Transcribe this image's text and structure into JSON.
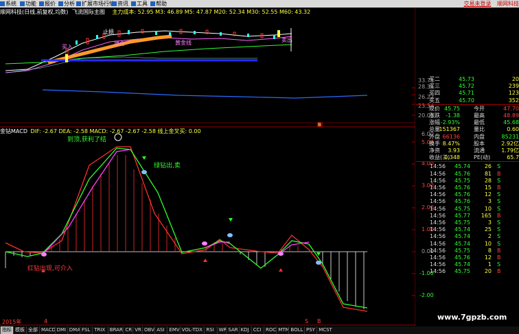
{
  "menu": {
    "items": [
      "系统",
      "功能",
      "报价",
      "分析",
      "扩展市场行情",
      "资讯",
      "工具",
      "帮助"
    ],
    "right_links": [
      "交易未登录",
      "顺网科技"
    ]
  },
  "top_panel": {
    "title": "顺网科技(日线,前复权,均数)",
    "indicator_name": "飞流国际主图",
    "indicators_text": "主力成本: 52.95  M3: 46.89  M5: 47.87  M20: 52.34  M30: 52.55  M60: 43.32",
    "annotations": [
      "止损",
      "建仓",
      "黄金线",
      "买入",
      "卖出"
    ],
    "y_ticks": [
      "33.71",
      "28.31",
      "26.22",
      "23.34",
      "20.05"
    ],
    "marker": "B"
  },
  "macd_panel": {
    "header_name": "金钻MACD",
    "header_values": "DIF: -2.67  DEA: -2.58  MACD: -2.67  -2.67  -2.58  线上金叉买: 0.00",
    "notes": {
      "top": "到顶,获利了结",
      "green_sell": "绿钻出,卖",
      "red_buy": "红钻出现,可介入"
    },
    "y_ticks": [
      "6.00",
      "5.00",
      "4.00",
      "3.00",
      "2.00",
      "1.00",
      "0.00",
      "-1.00",
      "-2.00"
    ],
    "bottom_labels": {
      "year": "2015年",
      "month": "4",
      "s_mark": "S",
      "b_mark": "B"
    }
  },
  "quote": {
    "bid_rows": [
      {
        "label": "买二",
        "price": "45.73",
        "vol": "20"
      },
      {
        "label": "买三",
        "price": "45.72",
        "vol": "239"
      },
      {
        "label": "买四",
        "price": "45.71",
        "vol": "123"
      },
      {
        "label": "买五",
        "price": "45.70",
        "vol": "352"
      }
    ],
    "stats": [
      {
        "l1": "现价",
        "v1": "45.75",
        "l2": "今开",
        "v2": "47.70"
      },
      {
        "l1": "涨跌",
        "v1": "-1.38",
        "l2": "最高",
        "v2": "48.89"
      },
      {
        "l1": "涨幅",
        "v1": "-2.93%",
        "l2": "最低",
        "v2": "45.68"
      },
      {
        "l1": "总量",
        "v1": "151367",
        "l2": "量比",
        "v2": "0.60"
      },
      {
        "l1": "外盘",
        "v1": "66136",
        "l2": "内盘",
        "v2": "85231"
      },
      {
        "l1": "换手",
        "v1": "8.47%",
        "l2": "股本",
        "v2": "2.92亿"
      },
      {
        "l1": "净资",
        "v1": "3.93",
        "l2": "流通",
        "v2": "1.79亿"
      },
      {
        "l1": "收益(三)",
        "v1": "0.348",
        "l2": "PE(动)",
        "v2": "65.7"
      }
    ],
    "ticks": [
      {
        "t": "14:56",
        "p": "45.74",
        "v": "26",
        "d": "S"
      },
      {
        "t": "14:56",
        "p": "45.76",
        "v": "81",
        "d": "B"
      },
      {
        "t": "14:56",
        "p": "45.75",
        "v": "28",
        "d": "S"
      },
      {
        "t": "14:56",
        "p": "45.76",
        "v": "15",
        "d": "B"
      },
      {
        "t": "14:56",
        "p": "45.76",
        "v": "12",
        "d": "S"
      },
      {
        "t": "14:56",
        "p": "45.76",
        "v": "3",
        "d": "S"
      },
      {
        "t": "14:56",
        "p": "45.75",
        "v": "10",
        "d": "S"
      },
      {
        "t": "14:56",
        "p": "45.77",
        "v": "165",
        "d": "B"
      },
      {
        "t": "14:56",
        "p": "45.75",
        "v": "3",
        "d": "S"
      },
      {
        "t": "14:56",
        "p": "45.74",
        "v": "25",
        "d": "S"
      },
      {
        "t": "14:56",
        "p": "45.74",
        "v": "2",
        "d": "S"
      },
      {
        "t": "14:56",
        "p": "45.74",
        "v": "10",
        "d": "S"
      },
      {
        "t": "14:56",
        "p": "45.75",
        "v": "8",
        "d": "B"
      },
      {
        "t": "14:56",
        "p": "45.76",
        "v": "12",
        "d": "B"
      },
      {
        "t": "14:56",
        "p": "45.74",
        "v": "1",
        "d": "S"
      },
      {
        "t": "14:56",
        "p": "45.75",
        "v": "20",
        "d": "B"
      }
    ]
  },
  "tabs": [
    "指标",
    "模板",
    "全部",
    "MACD",
    "DMI",
    "DMA",
    "FSL",
    "TRIX",
    "BRAR",
    "CR",
    "VR",
    "OBV",
    "ASI",
    "EMV",
    "VOL-TDX",
    "RSI",
    "WR",
    "SAR",
    "KDJ",
    "CCI",
    "ROC",
    "MTM",
    "BOLL",
    "PSY",
    "MCST"
  ],
  "watermark": "www.7gpzb.com",
  "colors": {
    "up": "#ff3030",
    "down": "#30ff30",
    "bg": "#000000",
    "axis": "#a00000",
    "text_red": "#ff4040",
    "text_yellow": "#ffff40"
  }
}
